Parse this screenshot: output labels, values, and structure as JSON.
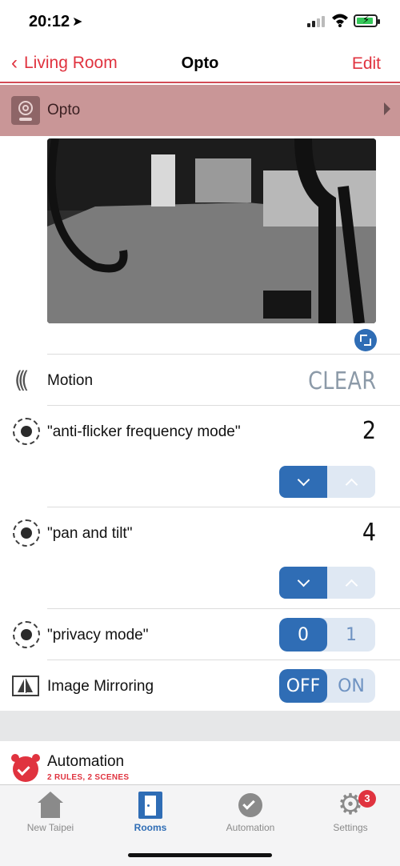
{
  "status_bar": {
    "time": "20:12"
  },
  "nav": {
    "back_label": "Living Room",
    "title": "Opto",
    "edit_label": "Edit"
  },
  "device": {
    "name": "Opto"
  },
  "motion": {
    "label": "Motion",
    "value": "CLEAR"
  },
  "controls": [
    {
      "label": "\"anti-flicker frequency mode\"",
      "value": "2"
    },
    {
      "label": "\"pan and tilt\"",
      "value": "4"
    }
  ],
  "privacy": {
    "label": "\"privacy mode\"",
    "options": [
      "0",
      "1"
    ],
    "selected": "0"
  },
  "mirroring": {
    "label": "Image Mirroring",
    "options": [
      "OFF",
      "ON"
    ],
    "selected": "OFF"
  },
  "automation": {
    "title": "Automation",
    "subtitle": "2 RULES, 2 SCENES"
  },
  "tabs": [
    {
      "label": "New Taipei",
      "icon": "house-icon"
    },
    {
      "label": "Rooms",
      "icon": "door-icon",
      "active": true
    },
    {
      "label": "Automation",
      "icon": "alarm-clock-icon"
    },
    {
      "label": "Settings",
      "icon": "gear-icon",
      "badge": "3"
    }
  ],
  "colors": {
    "accent": "#e0333f",
    "blue": "#2f6db5",
    "header_bg": "#c99697"
  }
}
